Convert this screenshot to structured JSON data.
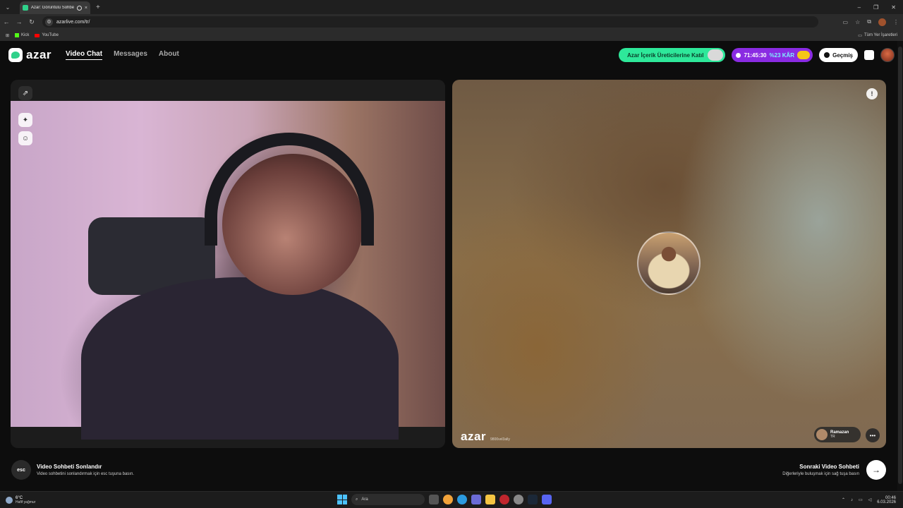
{
  "browser": {
    "tab_title": "Azar: Görüntülü Sohbet & Tanı",
    "tab_close": "×",
    "new_tab": "+",
    "url": "azarlive.com/tr/",
    "bookmarks": [
      {
        "label": "Kick",
        "icon": "kick-icon"
      },
      {
        "label": "YouTube",
        "icon": "youtube-icon"
      }
    ],
    "all_bookmarks": "Tüm Yer İşaretleri"
  },
  "header": {
    "logo_text": "azar",
    "nav": [
      {
        "label": "Video Chat",
        "active": true
      },
      {
        "label": "Messages",
        "active": false
      },
      {
        "label": "About",
        "active": false
      }
    ],
    "creator_cta": "Azar İçerik Üreticilerine Katıl",
    "timer": "71:45:30",
    "discount": "%23 KÂR",
    "history": "Geçmiş"
  },
  "peer": {
    "watermark": "azar",
    "watermark_id": "9800vel3ally",
    "name": "Ramazan",
    "country": "TR"
  },
  "footer": {
    "esc_key": "esc",
    "end_title": "Video Sohbeti Sonlandır",
    "end_sub": "Video sohbetini sonlandırmak için esc tuşuna basın.",
    "next_title": "Sonraki Video Sohbeti",
    "next_sub": "Diğerleriyle buluşmak için sağ tuşa basın"
  },
  "taskbar": {
    "temp": "6°C",
    "weather": "Hafif yağmur",
    "search_placeholder": "Ara",
    "time": "00:46",
    "date": "6.03.2026"
  },
  "colors": {
    "accent_green": "#2ee89a",
    "accent_purple": "#8a2be2",
    "background": "#0d0d0d"
  }
}
